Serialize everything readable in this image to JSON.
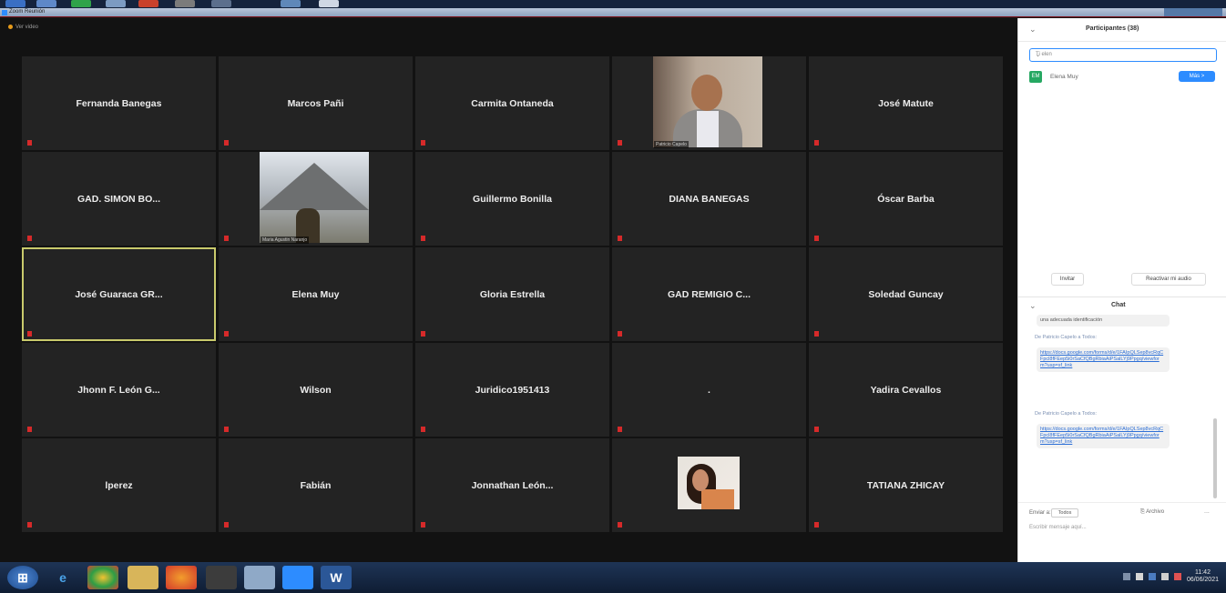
{
  "window": {
    "title": "Zoom Reunión"
  },
  "meeting": {
    "viewing_label": "Ver video",
    "tiles": [
      {
        "name": "Fernanda Banegas",
        "type": "name"
      },
      {
        "name": "Marcos Pañi",
        "type": "name"
      },
      {
        "name": "Carmita Ontaneda",
        "type": "name"
      },
      {
        "name": "",
        "type": "photo-man",
        "tag": "Patricio Capelo"
      },
      {
        "name": "José Matute",
        "type": "name"
      },
      {
        "name": "GAD. SIMON BO...",
        "type": "name"
      },
      {
        "name": "",
        "type": "photo-mountain",
        "tag": "Maria Agustin Naranjo"
      },
      {
        "name": "Guillermo Bonilla",
        "type": "name"
      },
      {
        "name": "DIANA BANEGAS",
        "type": "name"
      },
      {
        "name": "Óscar Barba",
        "type": "name"
      },
      {
        "name": "José Guaraca GR...",
        "type": "name",
        "active": true
      },
      {
        "name": "Elena Muy",
        "type": "name"
      },
      {
        "name": "Gloria Estrella",
        "type": "name"
      },
      {
        "name": "GAD REMIGIO C...",
        "type": "name"
      },
      {
        "name": "Soledad Guncay",
        "type": "name"
      },
      {
        "name": "Jhonn F. León G...",
        "type": "name"
      },
      {
        "name": "Wilson",
        "type": "name"
      },
      {
        "name": "Juridico1951413",
        "type": "name"
      },
      {
        "name": ".",
        "type": "name"
      },
      {
        "name": "Yadira Cevallos",
        "type": "name"
      },
      {
        "name": "lperez",
        "type": "name"
      },
      {
        "name": "Fabián",
        "type": "name"
      },
      {
        "name": "Jonnathan  León...",
        "type": "name"
      },
      {
        "name": "",
        "type": "photo-woman"
      },
      {
        "name": "TATIANA ZHICAY",
        "type": "name"
      }
    ]
  },
  "participants": {
    "title": "Participantes (38)",
    "search_placeholder": "Ti elen",
    "result": {
      "initials": "EM",
      "name": "Elena Muy",
      "action": "Más >"
    },
    "buttons": {
      "invite": "Invitar",
      "unmute": "Reactivar mi audio"
    }
  },
  "chat": {
    "title": "Chat",
    "messages": [
      {
        "kind": "text",
        "text": "una adecuada identificación"
      },
      {
        "kind": "from",
        "text": "De Patricio Capelo a Todos:"
      },
      {
        "kind": "link",
        "text": "https://docs.google.com/forms/d/e/1FAIpQLSep8vcRqCFpcl8fFEep5i0rSaCfQBgRbiaAiPSalLYj9Ppgq/viewform?usp=sf_link"
      },
      {
        "kind": "from",
        "text": "De Patricio Capelo a Todos:"
      },
      {
        "kind": "link",
        "text": "https://docs.google.com/forms/d/e/1FAIpQLSep8vcRqCFpcl8fFEep5i0rSaCfQBgRbiaAiPSalLYj9Ppgq/viewform?usp=sf_link"
      }
    ],
    "send_to_label": "Enviar a:",
    "send_to_value": "Todos",
    "file_label": "Archivo",
    "more_label": "...",
    "placeholder": "Escribir mensaje aquí..."
  },
  "taskbar": {
    "time": "11:42",
    "date": "06/06/2021",
    "icons": [
      "windows-start",
      "internet-explorer",
      "chrome",
      "file-explorer",
      "firefox",
      "media-player",
      "tablet",
      "zoom",
      "word"
    ]
  }
}
